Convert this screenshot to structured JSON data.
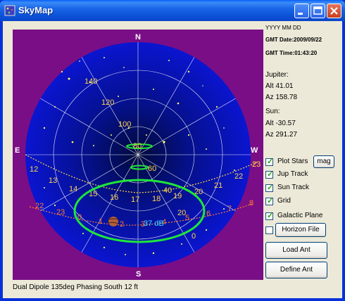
{
  "window": {
    "title": "SkyMap"
  },
  "sky": {
    "directions": {
      "north": "N",
      "south": "S",
      "east": "E",
      "west": "W"
    },
    "alt_rings": [
      "140",
      "120",
      "100",
      "80",
      "60",
      "40",
      "20",
      "0"
    ],
    "sun_track_hours": [
      "12",
      "13",
      "14",
      "15",
      "16",
      "17",
      "18",
      "19",
      "20",
      "21",
      "22",
      "23"
    ],
    "jup_track_hours": [
      "22",
      "23",
      "0",
      "1",
      "2",
      "3",
      "4",
      "5",
      "6",
      "7",
      "8"
    ],
    "contour_label": "37 dB",
    "colors": {
      "background": "#7a0e86",
      "sky": "#0a15d0",
      "grid": "#ffffff",
      "contour": "#1ee63a",
      "sun_track": "#ffd54a",
      "jup_track": "#ff7b30",
      "stars": "#ffff66"
    }
  },
  "info": {
    "date_format": "YYYY  MM  DD",
    "gmt_date": "GMT Date:2009/09/22",
    "gmt_time": "GMT Time:01:43:20",
    "jupiter": {
      "title": "Jupiter:",
      "alt": "Alt 41.01",
      "az": "Az 158.78"
    },
    "sun": {
      "title": "Sun:",
      "alt": "Alt -30.57",
      "az": "Az 291.27"
    }
  },
  "controls": {
    "plot_stars": {
      "label": "Plot Stars",
      "checked": true
    },
    "mag_button": "mag",
    "jup_track": {
      "label": "Jup Track",
      "checked": true
    },
    "sun_track": {
      "label": "Sun Track",
      "checked": true
    },
    "grid": {
      "label": "Grid",
      "checked": true
    },
    "galactic_plane": {
      "label": "Galactic Plane",
      "checked": true
    },
    "horizon_file": {
      "checked": false
    },
    "horizon_file_button": "Horizon File",
    "load_ant_button": "Load Ant",
    "define_ant_button": "Define Ant"
  },
  "status": {
    "text": "Dual Dipole 135deg Phasing South 12 ft"
  }
}
